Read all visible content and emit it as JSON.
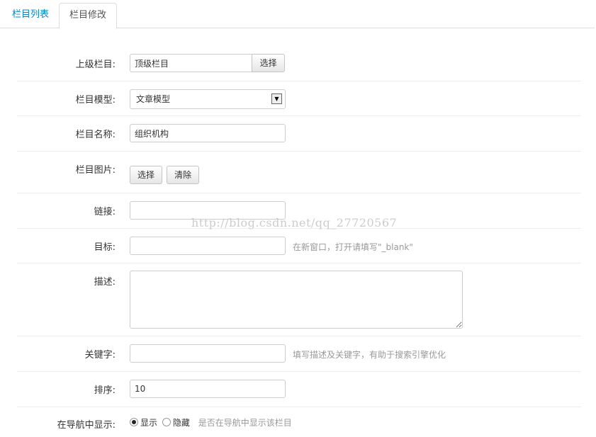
{
  "tabs": [
    {
      "label": "栏目列表"
    },
    {
      "label": "栏目修改"
    }
  ],
  "form": {
    "parent": {
      "label": "上级栏目:",
      "value": "顶级栏目",
      "button": "选择"
    },
    "model": {
      "label": "栏目模型:",
      "selected": "文章模型"
    },
    "name": {
      "label": "栏目名称:",
      "value": "组织机构"
    },
    "image": {
      "label": "栏目图片:",
      "select_button": "选择",
      "clear_button": "清除"
    },
    "link": {
      "label": "链接:",
      "value": ""
    },
    "target": {
      "label": "目标:",
      "value": "",
      "help": "在新窗口，打开请填写\"_blank\""
    },
    "description": {
      "label": "描述:",
      "value": ""
    },
    "keywords": {
      "label": "关键字:",
      "value": "",
      "help": "填写描述及关键字，有助于搜索引擎优化"
    },
    "sort": {
      "label": "排序:",
      "value": "10"
    },
    "nav_display": {
      "label": "在导航中显示:",
      "option_show": "显示",
      "option_hide": "隐藏",
      "selected": "显示",
      "help": "是否在导航中显示该栏目"
    }
  },
  "watermark": "http://blog.csdn.net/qq_27720567"
}
